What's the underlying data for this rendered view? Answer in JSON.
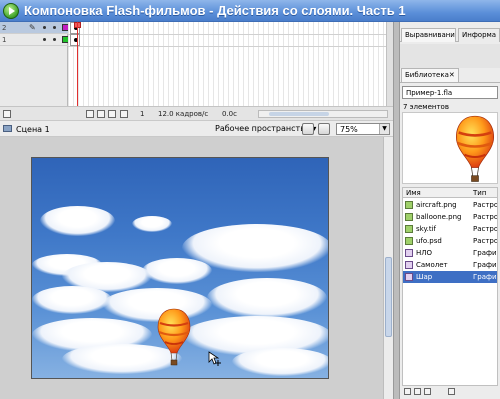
{
  "window": {
    "title": "Компоновка Flash-фильмов - Действия со слоями. Часть 1"
  },
  "timeline": {
    "layers": [
      {
        "number": "2",
        "selected": true,
        "swatch_color": "#c21fc2"
      },
      {
        "number": "1",
        "selected": false,
        "swatch_color": "#22c22b"
      }
    ],
    "current_frame": "1",
    "frame_rate": "12.0 кадров/с",
    "elapsed_time": "0.0с"
  },
  "editbar": {
    "scene_name": "Сцена 1",
    "workspace_label": "Рабочее пространство ▾",
    "zoom_value": "75%"
  },
  "panels": {
    "align_tab": "Выравнивание",
    "info_tab": "Информа",
    "library_tab": "Библиотека"
  },
  "library": {
    "file_selector": "Пример-1.fla",
    "item_count": "7 элементов",
    "columns": {
      "name": "Имя",
      "type": "Тип"
    },
    "items": [
      {
        "name": "aircraft.png",
        "type": "Растров",
        "icon": "bitmap-icon",
        "selected": false
      },
      {
        "name": "balloone.png",
        "type": "Растров",
        "icon": "bitmap-icon",
        "selected": false
      },
      {
        "name": "sky.tif",
        "type": "Растров",
        "icon": "bitmap-icon",
        "selected": false
      },
      {
        "name": "ufo.psd",
        "type": "Растров",
        "icon": "bitmap-icon",
        "selected": false
      },
      {
        "name": "НЛО",
        "type": "Графика",
        "icon": "graphic-symbol-icon",
        "selected": false
      },
      {
        "name": "Самолет",
        "type": "Графика",
        "icon": "graphic-symbol-icon",
        "selected": false
      },
      {
        "name": "Шар",
        "type": "Графика",
        "icon": "graphic-symbol-icon",
        "selected": true
      }
    ]
  },
  "colors": {
    "titlebar": "#5b8fd9",
    "selection": "#3e6fc4",
    "playhead": "#e03030",
    "sky": "#3f78c8"
  }
}
